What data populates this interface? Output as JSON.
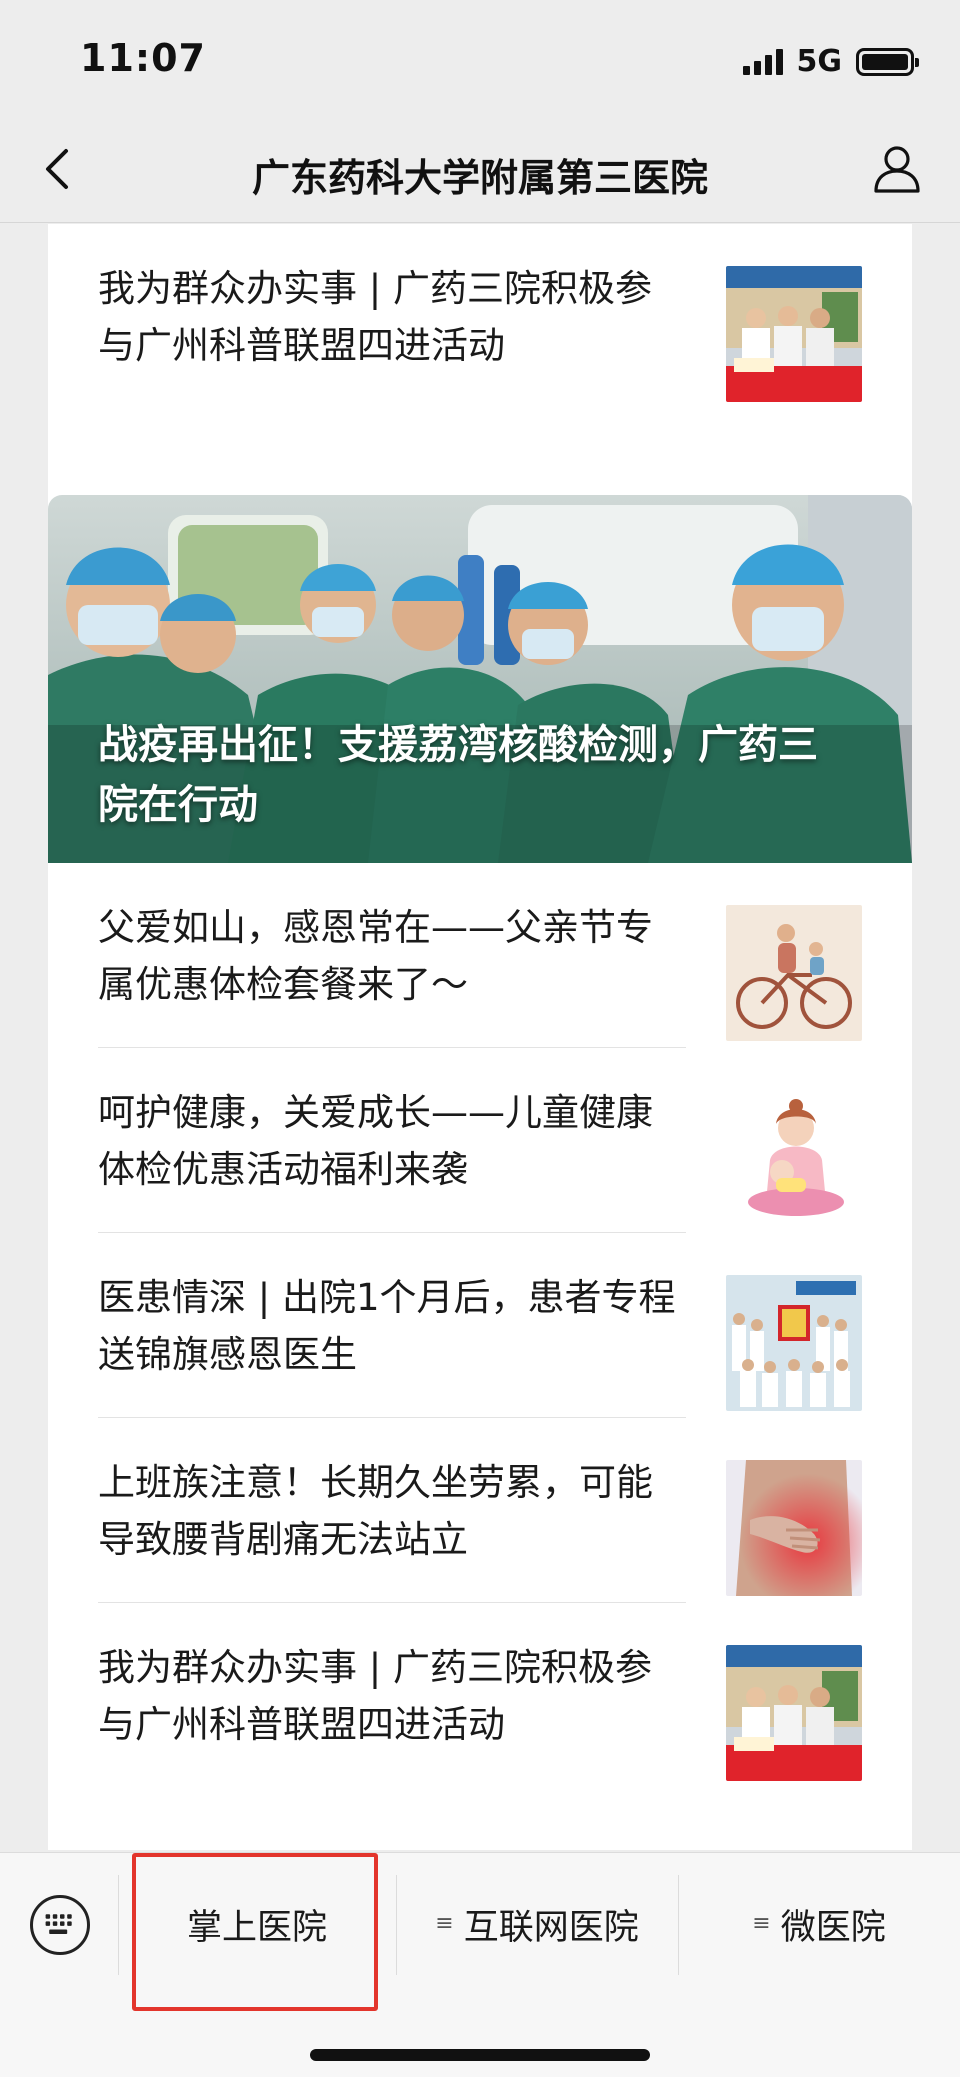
{
  "status_bar": {
    "time": "11:07",
    "network": "5G",
    "battery_level": 0.95
  },
  "nav": {
    "title": "广东药科大学附属第三医院"
  },
  "feed": {
    "card_a": {
      "articles": [
        {
          "title": "我为群众办实事 | 广药三院积极参与广州科普联盟四进活动",
          "thumb": "doctors-table-photo"
        }
      ]
    },
    "card_b": {
      "hero": {
        "title": "战疫再出征！支援荔湾核酸检测，广药三院在行动",
        "image": "medical-staff-ambulance-photo"
      },
      "articles": [
        {
          "title": "父爱如山，感恩常在——父亲节专属优惠体检套餐来了～",
          "thumb": "father-child-bicycle-illustration"
        },
        {
          "title": "呵护健康，关爱成长——儿童健康体检优惠活动福利来袭",
          "thumb": "mother-baby-illustration"
        },
        {
          "title": "医患情深 | 出院1个月后，患者专程送锦旗感恩医生",
          "thumb": "group-photo-banner"
        },
        {
          "title": "上班族注意！长期久坐劳累，可能导致腰背剧痛无法站立",
          "thumb": "back-pain-photo"
        },
        {
          "title": "我为群众办实事 | 广药三院积极参与广州科普联盟四进活动",
          "thumb": "doctors-table-photo"
        }
      ]
    }
  },
  "menu": {
    "items": [
      {
        "label": "掌上医院",
        "has_submenu": false,
        "highlighted": true
      },
      {
        "label": "互联网医院",
        "has_submenu": true,
        "highlighted": false
      },
      {
        "label": "微医院",
        "has_submenu": true,
        "highlighted": false
      }
    ],
    "submenu_glyph": "≡"
  },
  "colors": {
    "highlight": "#e3352c",
    "background": "#ededed",
    "card": "#ffffff"
  }
}
